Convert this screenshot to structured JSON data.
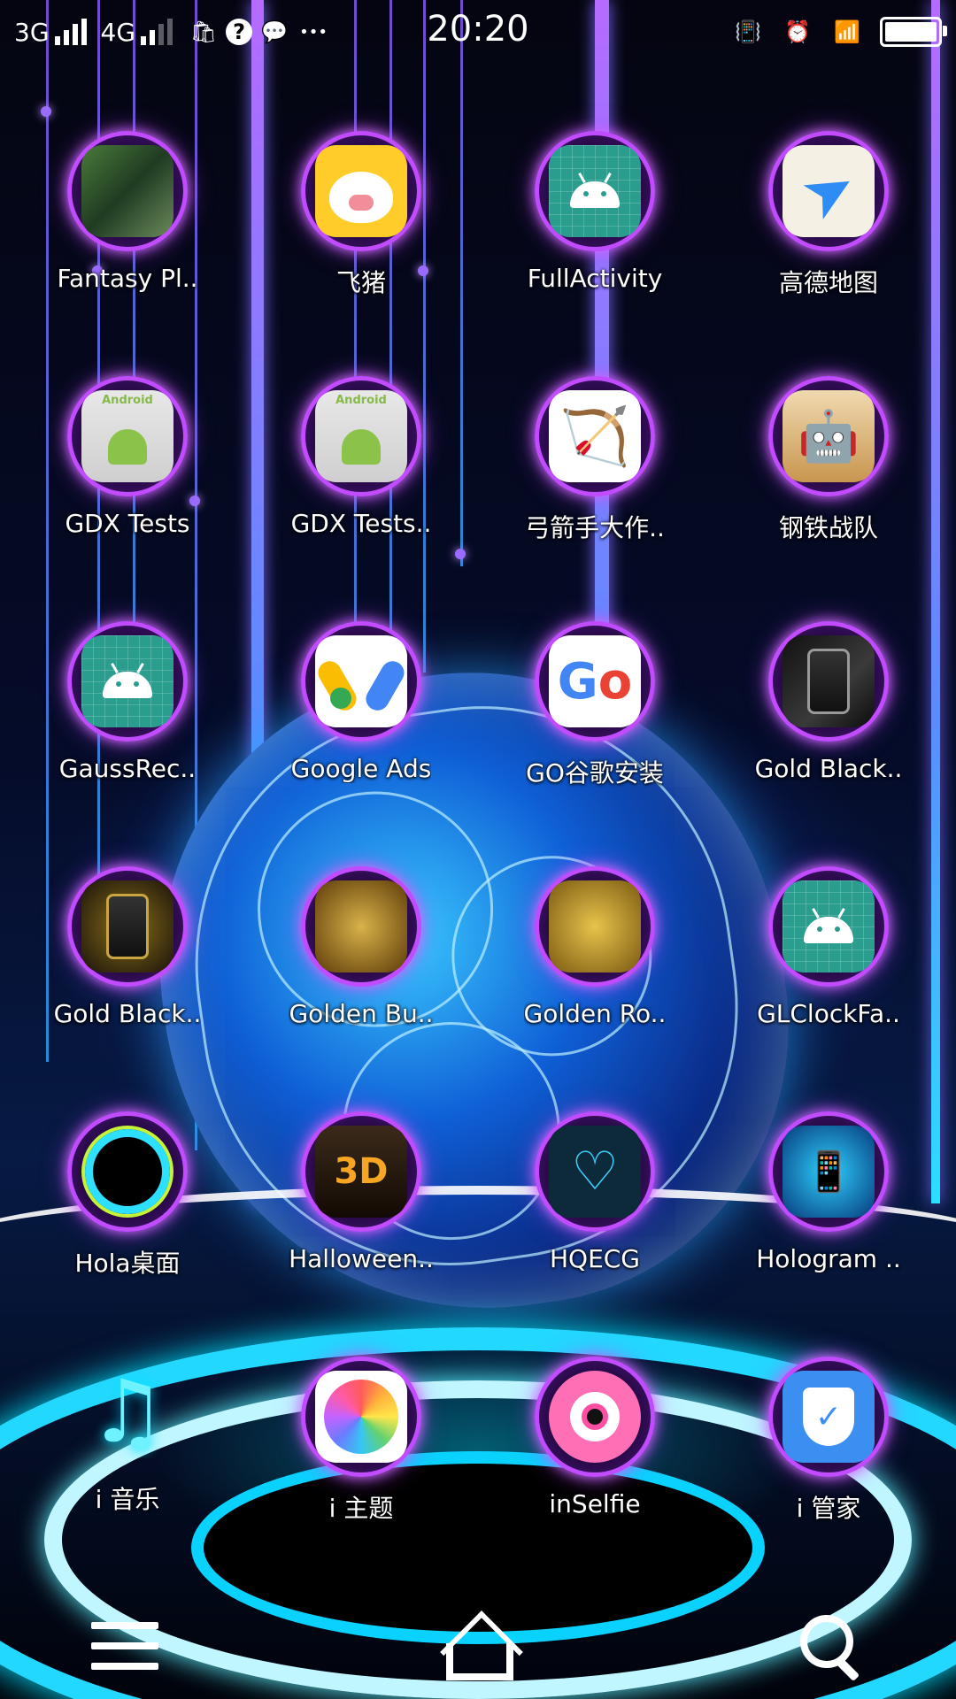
{
  "status_bar": {
    "network_1": "3G",
    "network_2": "4G",
    "time": "20:20",
    "icons_left": [
      "signal-bars-icon",
      "shopping-bag-icon",
      "question-icon",
      "chat-bubble-icon",
      "more-dots-icon"
    ],
    "icons_right": [
      "vibrate-icon",
      "alarm-clock-icon",
      "wifi-icon",
      "battery-icon"
    ],
    "battery_level": 0.9
  },
  "apps": [
    {
      "label": "Fantasy Pl..",
      "icon": "fantasy-theme-icon"
    },
    {
      "label": "飞猪",
      "icon": "feizhu-pig-icon"
    },
    {
      "label": "FullActivity",
      "icon": "android-icon"
    },
    {
      "label": "高德地图",
      "icon": "gaode-map-icon"
    },
    {
      "label": "GDX Tests",
      "icon": "gdx-android-icon"
    },
    {
      "label": "GDX Tests..",
      "icon": "gdx-android-icon"
    },
    {
      "label": "弓箭手大作..",
      "icon": "bow-arrow-icon"
    },
    {
      "label": "钢铁战队",
      "icon": "steel-squad-icon"
    },
    {
      "label": "GaussRec..",
      "icon": "android-icon"
    },
    {
      "label": "Google Ads",
      "icon": "google-ads-icon"
    },
    {
      "label": "GO谷歌安装",
      "icon": "google-go-icon"
    },
    {
      "label": "Gold Black..",
      "icon": "gold-black-theme-icon"
    },
    {
      "label": "Gold Black..",
      "icon": "gold-black-theme-icon"
    },
    {
      "label": "Golden Bu..",
      "icon": "golden-butterfly-icon"
    },
    {
      "label": "Golden Ro..",
      "icon": "golden-rose-icon"
    },
    {
      "label": "GLClockFa..",
      "icon": "android-icon"
    },
    {
      "label": "Hola桌面",
      "icon": "hola-launcher-icon"
    },
    {
      "label": "Halloween..",
      "icon": "halloween-theme-icon"
    },
    {
      "label": "HQECG",
      "icon": "heart-ecg-icon"
    },
    {
      "label": "Hologram ..",
      "icon": "hologram-theme-icon"
    }
  ],
  "dock": [
    {
      "label": "i 音乐",
      "icon": "music-note-icon"
    },
    {
      "label": "i 主题",
      "icon": "theme-pinwheel-icon"
    },
    {
      "label": "inSelfie",
      "icon": "selfie-camera-icon"
    },
    {
      "label": "i 管家",
      "icon": "security-shield-icon"
    }
  ],
  "nav": {
    "menu_icon": "menu-icon",
    "home_icon": "home-icon",
    "search_icon": "search-icon"
  },
  "glyphs": {
    "question": "?",
    "chat": "💬",
    "dots": "•••",
    "vibrate": "📳",
    "alarm": "⏰",
    "wifi": "📶",
    "bag": "🛍",
    "music": "♫",
    "bow": "🏹",
    "steel": "🤖",
    "heart": "♡",
    "holo": "📱",
    "halloween": "3D",
    "check": "✓",
    "plane": "➤",
    "g1": "G",
    "g2": "o"
  }
}
